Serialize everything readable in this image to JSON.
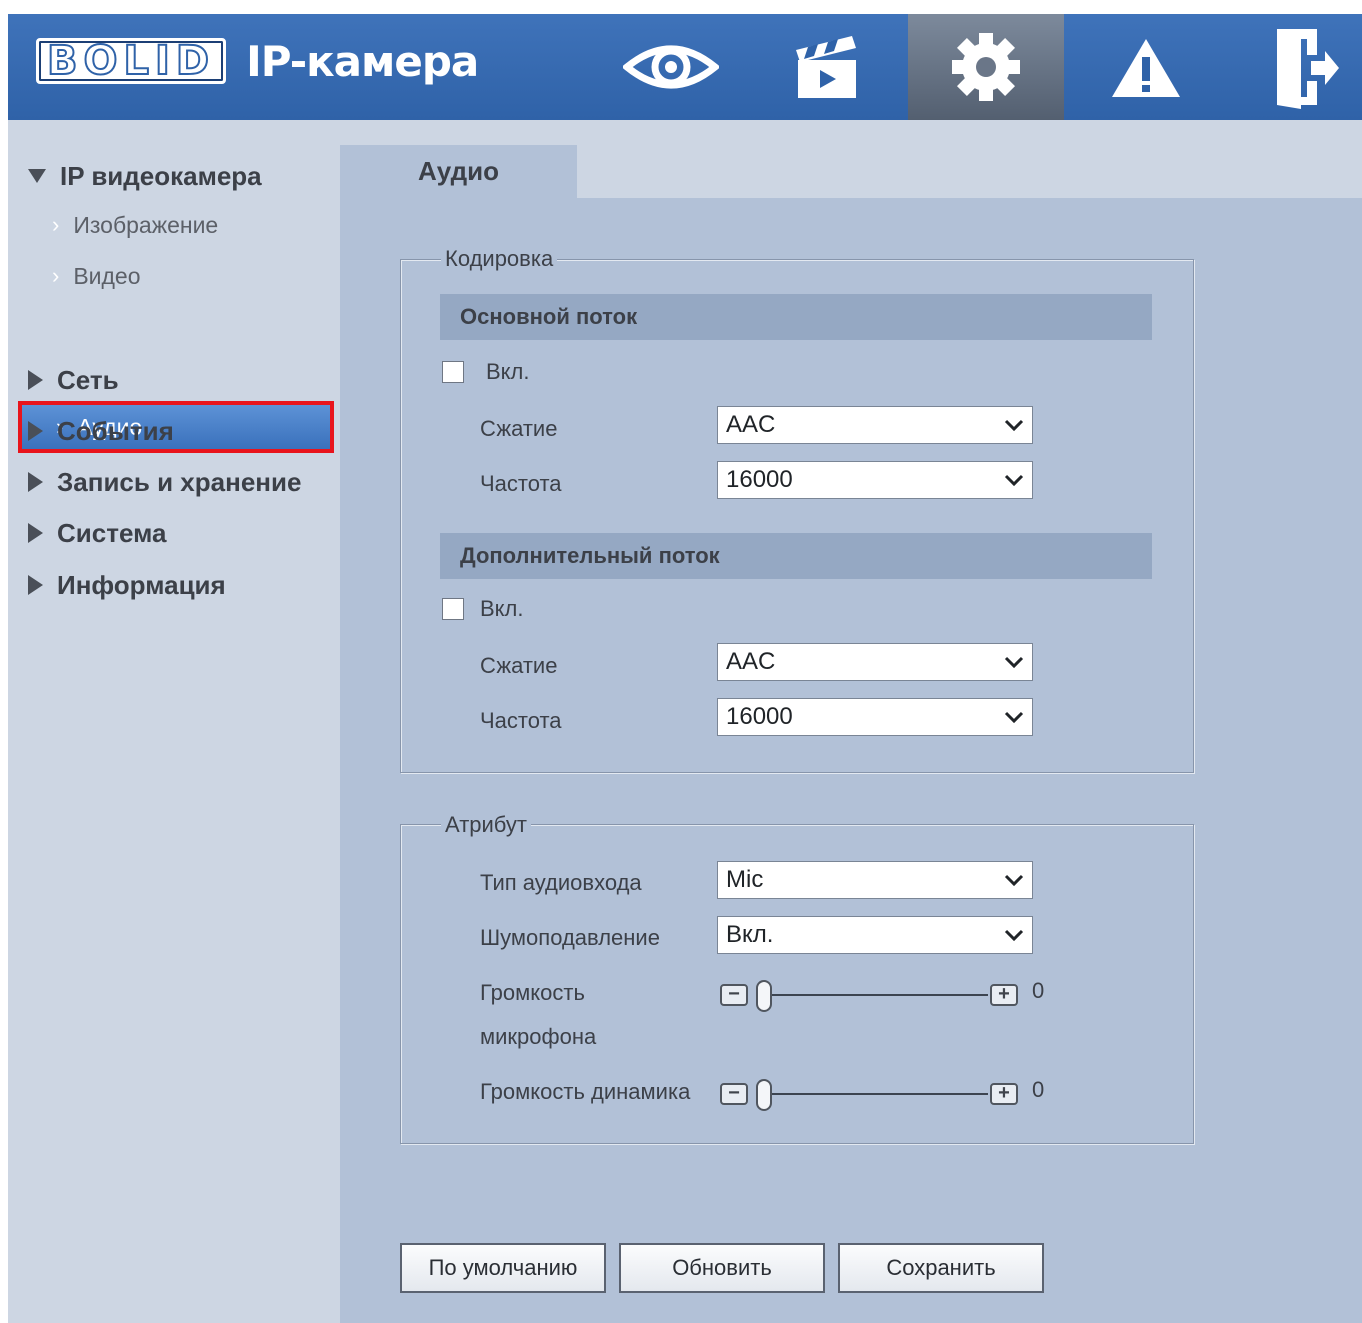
{
  "header": {
    "logo_text": "BOLID",
    "app_title": "IP-камера",
    "nav": [
      {
        "icon": "eye-icon",
        "name": "live"
      },
      {
        "icon": "clapperboard-icon",
        "name": "playback"
      },
      {
        "icon": "gear-icon",
        "name": "settings",
        "active": true
      },
      {
        "icon": "warning-icon",
        "name": "alarm"
      },
      {
        "icon": "logout-icon",
        "name": "logout"
      }
    ]
  },
  "sidebar": {
    "section_title": "IP видеокамера",
    "sub_items": [
      "Изображение",
      "Видео",
      "Аудио"
    ],
    "selected": "Аудио",
    "top_items": [
      "Сеть",
      "События",
      "Запись и хранение",
      "Система",
      "Информация"
    ]
  },
  "tab": {
    "label": "Аудио"
  },
  "encoding": {
    "legend": "Кодировка",
    "main_stream": {
      "title": "Основной поток",
      "enable_label": "Вкл.",
      "enabled": false,
      "compression_label": "Сжатие",
      "compression_value": "AAC",
      "frequency_label": "Частота",
      "frequency_value": "16000"
    },
    "sub_stream": {
      "title": "Дополнительный поток",
      "enable_label": "Вкл.",
      "enabled": false,
      "compression_label": "Сжатие",
      "compression_value": "AAC",
      "frequency_label": "Частота",
      "frequency_value": "16000"
    }
  },
  "attribute": {
    "legend": "Атрибут",
    "input_type_label": "Тип аудиовхода",
    "input_type_value": "Mic",
    "noise_label": "Шумоподавление",
    "noise_value": "Вкл.",
    "mic_volume_label_1": "Громкость",
    "mic_volume_label_2": "микрофона",
    "mic_volume_value": "0",
    "speaker_volume_label": "Громкость динамика",
    "speaker_volume_value": "0"
  },
  "buttons": {
    "default": "По умолчанию",
    "refresh": "Обновить",
    "save": "Сохранить"
  },
  "colors": {
    "header": "#2f62a8",
    "selected_item": "#3a71bc",
    "highlight_border": "#e8141c",
    "content_bg": "#b2c1d7"
  }
}
